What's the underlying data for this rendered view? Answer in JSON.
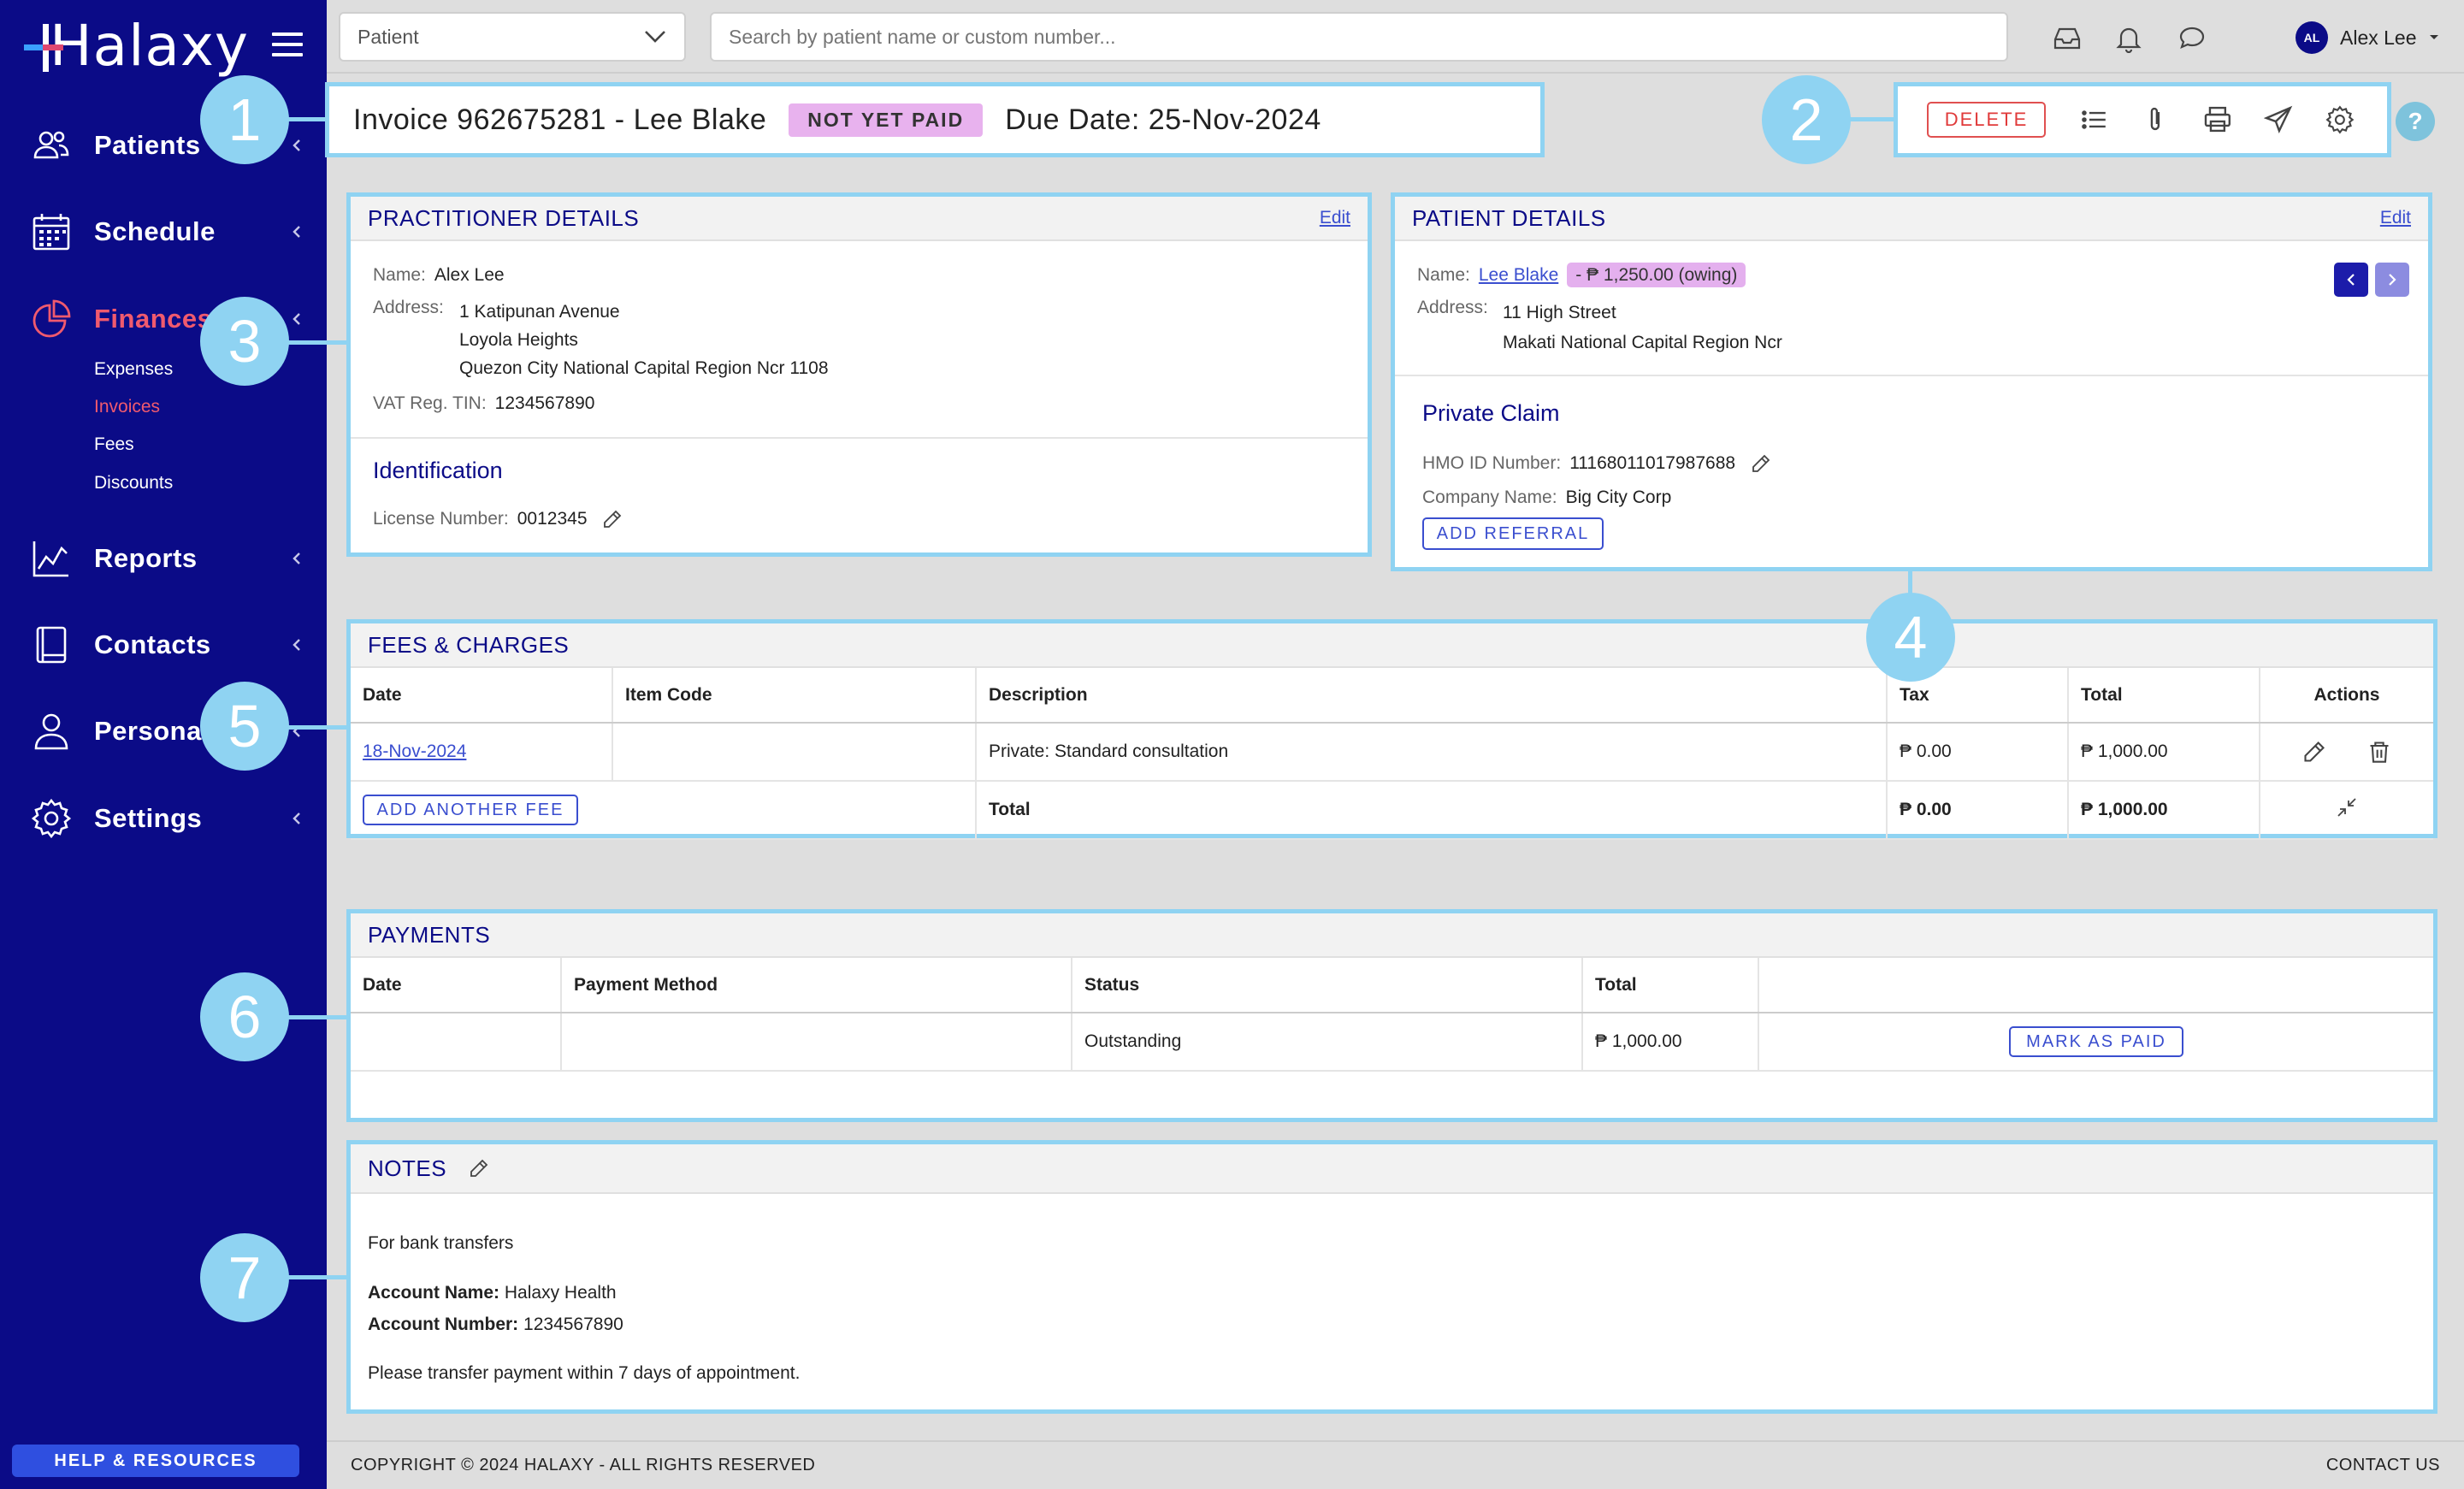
{
  "sidebar": {
    "logo": "Halaxy",
    "nav": [
      {
        "label": "Patients",
        "icon": "patients-icon"
      },
      {
        "label": "Schedule",
        "icon": "calendar-icon"
      },
      {
        "label": "Finances",
        "icon": "pie-chart-icon",
        "active": true
      },
      {
        "label": "Reports",
        "icon": "line-chart-icon"
      },
      {
        "label": "Contacts",
        "icon": "address-book-icon"
      },
      {
        "label": "Personal",
        "icon": "person-icon"
      },
      {
        "label": "Settings",
        "icon": "gear-icon"
      }
    ],
    "finances_sub": [
      "Expenses",
      "Invoices",
      "Fees",
      "Discounts"
    ],
    "active_sub": "Invoices",
    "help_label": "HELP & RESOURCES"
  },
  "topbar": {
    "patient_select": "Patient",
    "search_placeholder": "Search by patient name or custom number...",
    "user_initials": "AL",
    "user_name": "Alex Lee"
  },
  "invoice": {
    "title": "Invoice 962675281 - Lee Blake",
    "status": "NOT YET PAID",
    "due_date": "Due Date: 25-Nov-2024"
  },
  "toolbar": {
    "delete_label": "DELETE",
    "help": "?"
  },
  "practitioner": {
    "heading": "PRACTITIONER DETAILS",
    "edit": "Edit",
    "name_label": "Name:",
    "name": "Alex Lee",
    "address_label": "Address:",
    "address": [
      "1 Katipunan Avenue",
      "Loyola Heights",
      "Quezon City National Capital Region Ncr 1108"
    ],
    "vat_label": "VAT Reg. TIN:",
    "vat": "1234567890",
    "id_heading": "Identification",
    "license_label": "License Number:",
    "license": "0012345"
  },
  "patient": {
    "heading": "PATIENT DETAILS",
    "edit": "Edit",
    "name_label": "Name:",
    "name": "Lee Blake",
    "owing": "- ₱ 1,250.00 (owing)",
    "address_label": "Address:",
    "address": [
      "11 High Street",
      "Makati National Capital Region Ncr"
    ],
    "claim_heading": "Private Claim",
    "hmo_label": "HMO ID Number:",
    "hmo": "11168011017987688",
    "company_label": "Company Name:",
    "company": "Big City Corp",
    "referral_btn": "ADD REFERRAL"
  },
  "fees": {
    "heading": "FEES & CHARGES",
    "columns": [
      "Date",
      "Item Code",
      "Description",
      "Tax",
      "Total",
      "Actions"
    ],
    "rows": [
      {
        "date": "18-Nov-2024",
        "code": "",
        "description": "Private: Standard consultation",
        "tax": "₱ 0.00",
        "total": "₱ 1,000.00"
      }
    ],
    "add_btn": "ADD ANOTHER FEE",
    "total_label": "Total",
    "total_tax": "₱ 0.00",
    "total_amount": "₱ 1,000.00"
  },
  "payments": {
    "heading": "PAYMENTS",
    "columns": [
      "Date",
      "Payment Method",
      "Status",
      "Total",
      ""
    ],
    "rows": [
      {
        "date": "",
        "method": "",
        "status": "Outstanding",
        "total": "₱ 1,000.00"
      }
    ],
    "mark_paid_btn": "MARK AS PAID"
  },
  "notes": {
    "heading": "NOTES",
    "intro": "For bank transfers",
    "account_name_label": "Account Name:",
    "account_name": "Halaxy Health",
    "account_number_label": "Account Number:",
    "account_number": "1234567890",
    "footer_text": "Please transfer payment within 7 days of appointment."
  },
  "callouts": [
    "1",
    "2",
    "3",
    "4",
    "5",
    "6",
    "7"
  ],
  "footer": {
    "copyright": "COPYRIGHT © 2024 HALAXY - ALL RIGHTS RESERVED",
    "contact": "CONTACT US"
  },
  "colors": {
    "sidebar_bg": "#0b0b87",
    "accent_active": "#f05a6e",
    "callout": "#8fd3f2",
    "status_badge": "#e8b2ee",
    "link": "#3a4ecf"
  }
}
